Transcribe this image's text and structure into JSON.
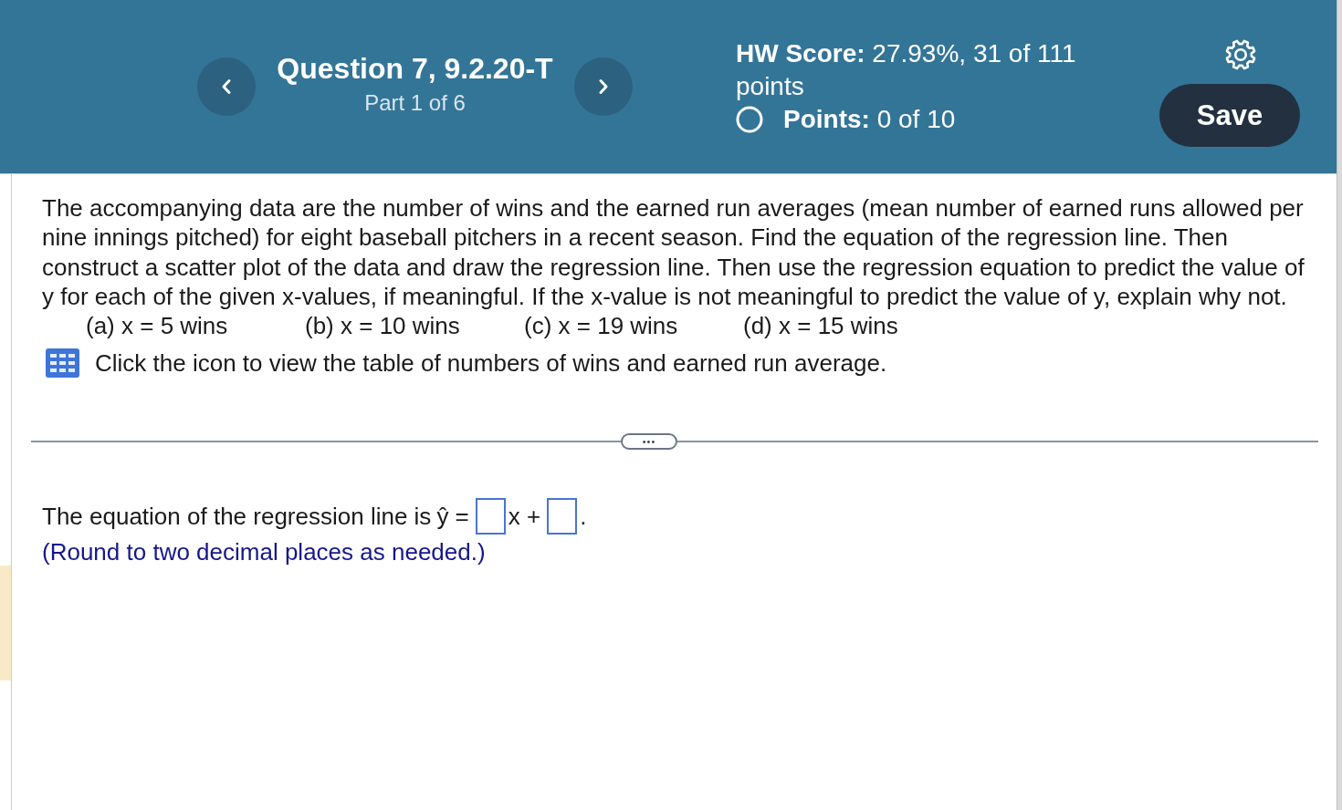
{
  "header": {
    "question_title": "Question 7, 9.2.20-T",
    "part": "Part 1 of 6",
    "hw_score": "**HW Score:** 27.93%, 31 of 111 points",
    "points": "**Points:** 0 of 10",
    "save_button": "Save"
  },
  "question": {
    "text": "The accompanying data are the number of wins and the earned run averages (mean number of earned runs allowed per nine innings pitched) for eight baseball pitchers in a recent season. Find the equation of the regression line. Then construct a scatter plot of the data and draw the regression line. Then use the regression equation to predict the value of y for each of the given x-values, if meaningful. If the x-value is not meaningful to predict the value of y, explain why not.",
    "options": [
      "(a) x = 5 wins",
      "(b) x = 10 wins",
      "(c) x = 19 wins",
      "(d) x = 15 wins"
    ],
    "table_link": "Click the icon to view the table of numbers of wins and earned run average."
  },
  "divider": {
    "expand_button": "•••"
  },
  "answer": {
    "parts": [
      {
        "kind": "text",
        "text": "The equation of the regression line is"
      },
      {
        "kind": "text",
        "text": "ŷ ="
      },
      {
        "kind": "blank"
      },
      {
        "kind": "text",
        "text": "x +"
      },
      {
        "kind": "blank"
      },
      {
        "kind": "text",
        "text": "."
      }
    ],
    "hint": "(Round to two decimal places as needed.)"
  }
}
